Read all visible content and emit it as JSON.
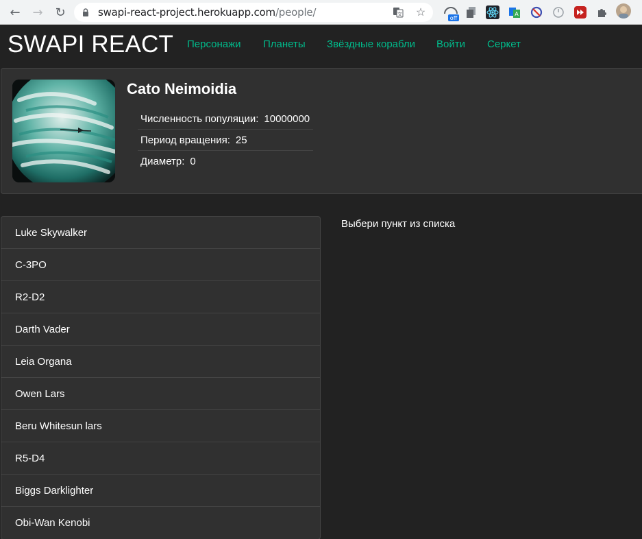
{
  "browser": {
    "url_host": "swapi-react-project.herokuapp.com",
    "url_path": "/people/",
    "extension_badge": "off"
  },
  "header": {
    "brand": "SWAPI REACT",
    "nav": [
      "Персонажи",
      "Планеты",
      "Звёздные корабли",
      "Войти",
      "Серкет"
    ],
    "link_color": "#00bc8c"
  },
  "planet": {
    "name": "Cato Neimoidia",
    "props": [
      {
        "label": "Численность популяции:",
        "value": "10000000"
      },
      {
        "label": "Период вращения:",
        "value": "25"
      },
      {
        "label": "Диаметр:",
        "value": "0"
      }
    ]
  },
  "people": [
    "Luke Skywalker",
    "C-3PO",
    "R2-D2",
    "Darth Vader",
    "Leia Organa",
    "Owen Lars",
    "Beru Whitesun lars",
    "R5-D4",
    "Biggs Darklighter",
    "Obi-Wan Kenobi"
  ],
  "details": {
    "placeholder": "Выбери пункт из списка"
  }
}
